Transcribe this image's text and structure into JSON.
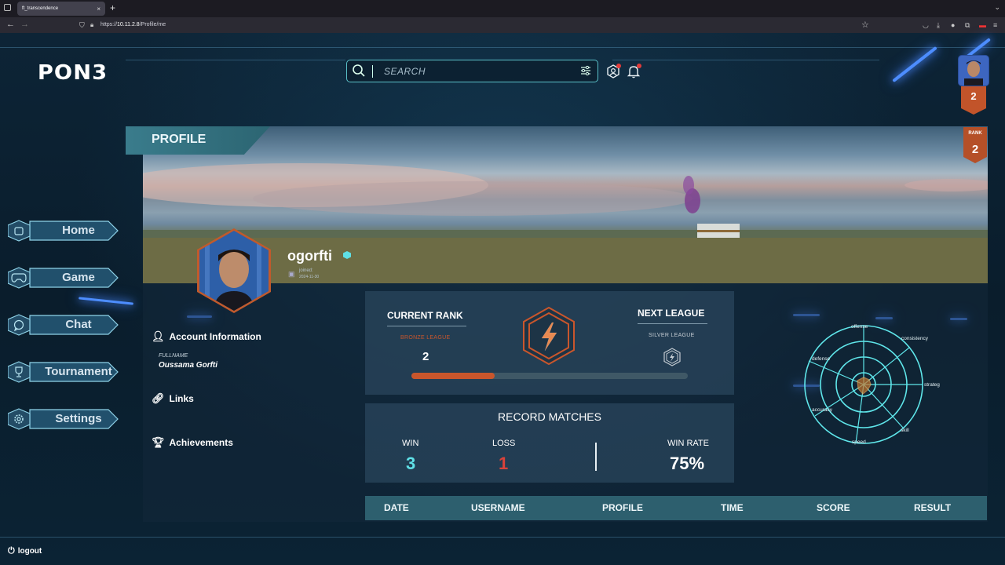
{
  "browser": {
    "tab_title": "ft_transcendence",
    "close_glyph": "×",
    "new_tab_glyph": "+",
    "url_prefix": "https://",
    "url_host": "10.11.2.8",
    "url_path": "/Profile/me"
  },
  "header": {
    "logo": "PON3",
    "search_placeholder": "SEARCH",
    "user_level": "2"
  },
  "sidebar": {
    "items": [
      {
        "label": "Home",
        "icon": "home-icon"
      },
      {
        "label": "Game",
        "icon": "gamepad-icon"
      },
      {
        "label": "Chat",
        "icon": "chat-icon"
      },
      {
        "label": "Tournament",
        "icon": "trophy-icon"
      },
      {
        "label": "Settings",
        "icon": "gear-icon"
      }
    ],
    "logout_label": "logout"
  },
  "profile": {
    "section_title": "PROFILE",
    "rank_label": "RANK",
    "rank_value": "2",
    "username": "ogorfti",
    "joined_label": "joined:",
    "joined_date": "2024-11-30",
    "account_info_label": "Account Information",
    "fullname_label": "FULLNAME",
    "fullname_value": "Oussama Gorfti",
    "links_label": "Links",
    "achievements_label": "Achievements"
  },
  "rank_card": {
    "current_title": "CURRENT RANK",
    "current_league": "BRONZE LEAGUE",
    "current_value": "2",
    "next_title": "NEXT LEAGUE",
    "next_league": "SILVER LEAGUE",
    "progress": 0.3,
    "colors": {
      "bronze": "#c9562c",
      "silver": "#c4ccd2"
    }
  },
  "record": {
    "title": "RECORD MATCHES",
    "win_label": "WIN",
    "win_value": "3",
    "loss_label": "LOSS",
    "loss_value": "1",
    "winrate_label": "WIN RATE",
    "winrate_value": "75%",
    "colors": {
      "win": "#5fe0e6",
      "loss": "#d9423a"
    }
  },
  "skills": {
    "labels": [
      "offense",
      "consistency",
      "strateg",
      "skill",
      "speed",
      "accuracy",
      "defense"
    ]
  },
  "history": {
    "columns": [
      "DATE",
      "USERNAME",
      "PROFILE",
      "TIME",
      "SCORE",
      "RESULT"
    ]
  }
}
